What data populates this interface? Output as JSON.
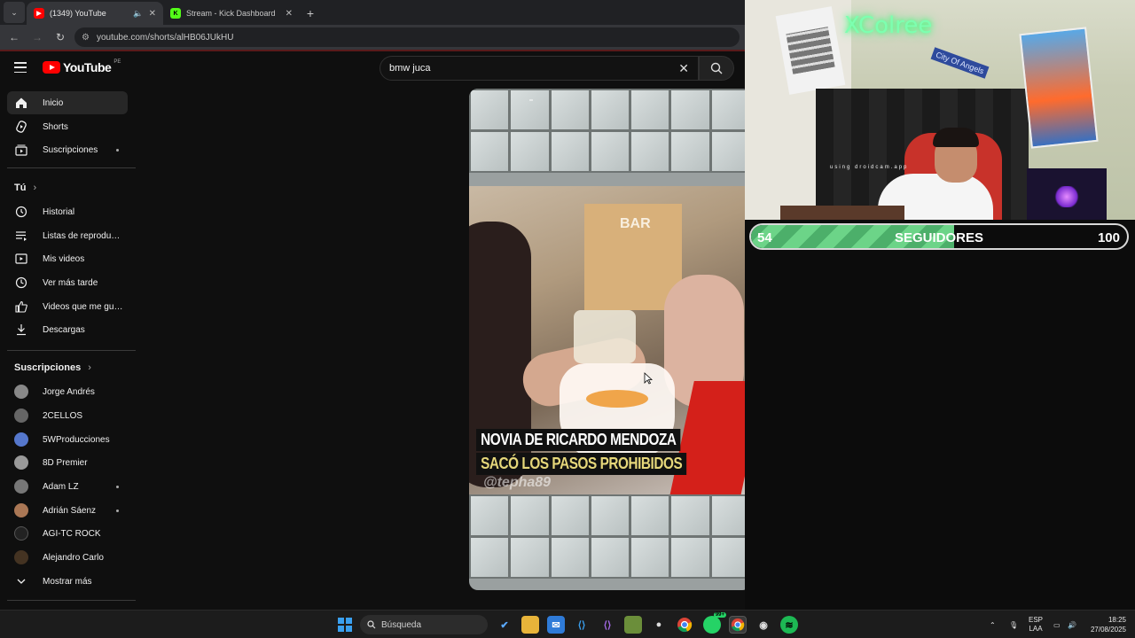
{
  "browser": {
    "tabs": [
      {
        "title": "(1349) YouTube",
        "active": true
      },
      {
        "title": "Stream - Kick Dashboard",
        "active": false
      }
    ],
    "url": "youtube.com/shorts/alHB06JUkHU"
  },
  "youtube": {
    "logo_text": "YouTube",
    "country_code": "PE",
    "search": {
      "value": "bmw juca"
    },
    "sidebar": {
      "main": [
        {
          "label": "Inicio",
          "icon": "home-icon",
          "active": true
        },
        {
          "label": "Shorts",
          "icon": "shorts-icon"
        },
        {
          "label": "Suscripciones",
          "icon": "subscriptions-icon",
          "dot": true
        }
      ],
      "you_heading": "Tú",
      "you": [
        {
          "label": "Historial",
          "icon": "history-icon"
        },
        {
          "label": "Listas de reproducc...",
          "icon": "playlist-icon"
        },
        {
          "label": "Mis videos",
          "icon": "my-videos-icon"
        },
        {
          "label": "Ver más tarde",
          "icon": "watch-later-icon"
        },
        {
          "label": "Videos que me gus...",
          "icon": "like-icon"
        },
        {
          "label": "Descargas",
          "icon": "download-icon"
        }
      ],
      "subs_heading": "Suscripciones",
      "subscriptions": [
        {
          "label": "Jorge Andrés",
          "color": "#888888"
        },
        {
          "label": "2CELLOS",
          "color": "#666666"
        },
        {
          "label": "5WProducciones",
          "color": "#5577cc"
        },
        {
          "label": "8D Premier",
          "color": "#999999"
        },
        {
          "label": "Adam LZ",
          "color": "#777777",
          "dot": true
        },
        {
          "label": "Adrián Sáenz",
          "color": "#aa7755",
          "dot": true
        },
        {
          "label": "AGI-TC ROCK",
          "color": "#222222"
        },
        {
          "label": "Alejandro Carlo",
          "color": "#443322"
        }
      ],
      "show_more": "Mostrar más"
    },
    "short": {
      "caption_line1": "NOVIA DE RICARDO MENDOZA",
      "caption_line2": "SACÓ LOS PASOS PROHIBIDOS",
      "watermark": "@tepha89",
      "bar_sign": "BAR"
    }
  },
  "stream_overlay": {
    "neon_sign": "XColree",
    "street_sign": "City Of Angels",
    "droidcam": "using droidcam.app",
    "followers": {
      "label": "SEGUIDORES",
      "current": "54",
      "goal": "100",
      "progress": 0.54
    }
  },
  "taskbar": {
    "search_placeholder": "Búsqueda",
    "whatsapp_badge": "99+",
    "lang_line1": "ESP",
    "lang_line2": "LAA",
    "time": "18:25",
    "date": "27/08/2025"
  },
  "colors": {
    "yt_red": "#ff0000",
    "progress_green": "#4caf6a",
    "caption_yellow": "#e6d77a"
  }
}
